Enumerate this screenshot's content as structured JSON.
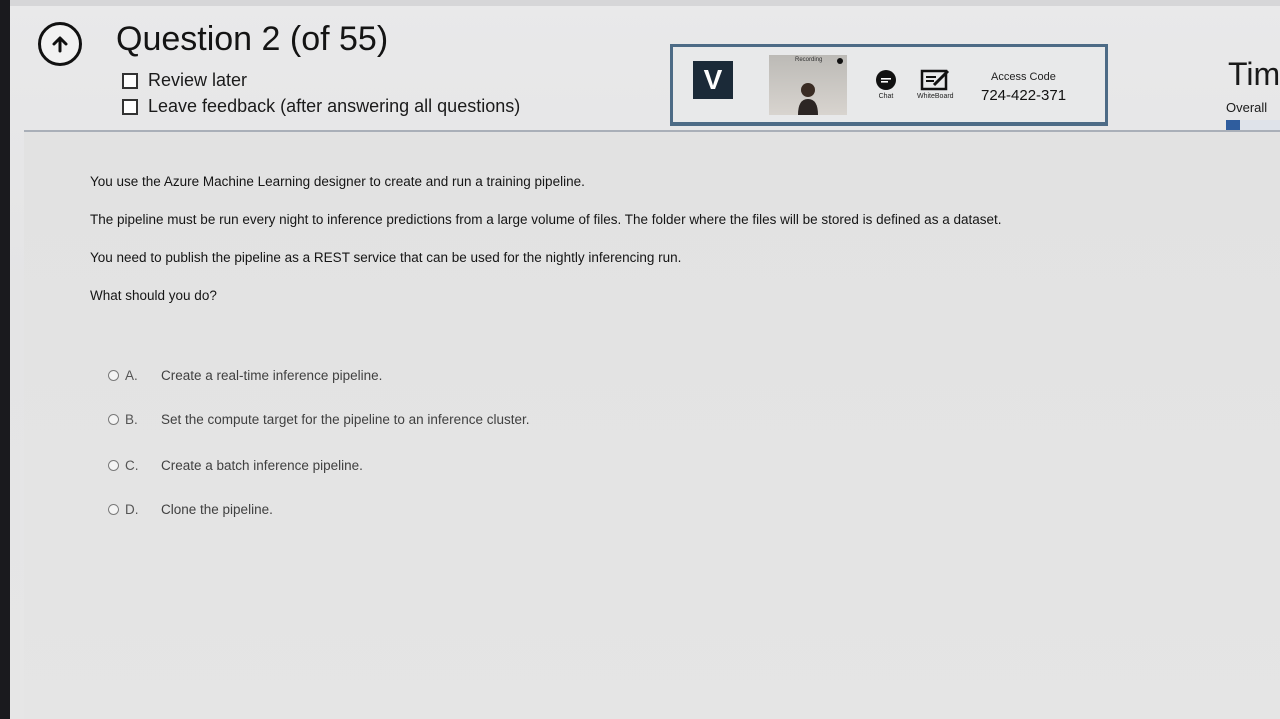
{
  "header": {
    "question_title": "Question 2 (of 55)",
    "review_later_label": "Review later",
    "leave_feedback_label": "Leave feedback (after answering all questions)"
  },
  "proctor": {
    "logo_letter": "V",
    "recording_label": "Recording",
    "chat_label": "Chat",
    "whiteboard_label": "WhiteBoard",
    "access_code_label": "Access Code",
    "access_code_value": "724-422-371"
  },
  "timer": {
    "title": "Tim",
    "overall_label": "Overall",
    "overall_progress_fraction": 0.25
  },
  "question": {
    "stem": [
      "You use the Azure Machine Learning designer to create and run a training pipeline.",
      "The pipeline must be run every night to inference predictions from a large volume of files. The folder where the files will be stored is defined as a dataset.",
      "You need to publish the pipeline as a REST service that can be used for the nightly inferencing run.",
      "What should you do?"
    ],
    "options": [
      {
        "letter": "A.",
        "text": "Create a real-time inference pipeline."
      },
      {
        "letter": "B.",
        "text": "Set the compute target for the pipeline to an inference cluster."
      },
      {
        "letter": "C.",
        "text": "Create a batch inference pipeline."
      },
      {
        "letter": "D.",
        "text": "Clone the pipeline."
      }
    ]
  },
  "colors": {
    "panel_border": "#4d6b86",
    "progress_fill": "#2f5d9e",
    "logo_bg": "#1b2a38"
  }
}
